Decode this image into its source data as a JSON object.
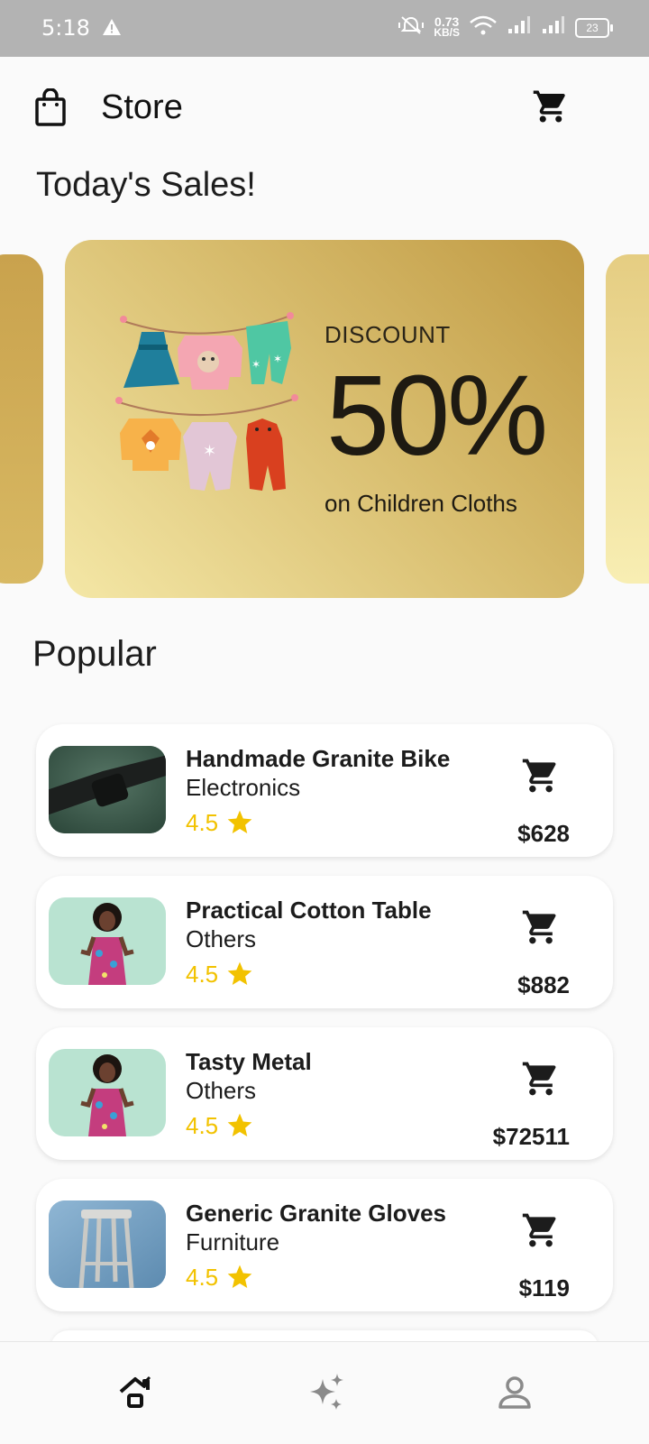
{
  "status": {
    "time": "5:18",
    "speed_value": "0.73",
    "speed_unit": "KB/S",
    "battery": "23"
  },
  "header": {
    "title": "Store"
  },
  "sales": {
    "title": "Today's Sales!",
    "banner": {
      "label": "DISCOUNT",
      "percent": "50%",
      "subtitle": "on Children Cloths"
    }
  },
  "popular": {
    "title": "Popular",
    "items": [
      {
        "name": "Handmade Granite Bike",
        "category": "Electronics",
        "rating": "4.5",
        "price": "$628"
      },
      {
        "name": "Practical Cotton Table",
        "category": "Others",
        "rating": "4.5",
        "price": "$882"
      },
      {
        "name": "Tasty Metal",
        "category": "Others",
        "rating": "4.5",
        "price": "$72511"
      },
      {
        "name": "Generic Granite Gloves",
        "category": "Furniture",
        "rating": "4.5",
        "price": "$119"
      }
    ]
  },
  "icons": {
    "bag": "shopping-bag-icon",
    "cart": "cart-icon",
    "star": "star-icon",
    "nav": [
      "home-icon",
      "sparkle-icon",
      "profile-icon"
    ]
  },
  "colors": {
    "accent_gold": "#c09a43",
    "rating_yellow": "#f2c200",
    "text_dark": "#1c1c1c"
  }
}
